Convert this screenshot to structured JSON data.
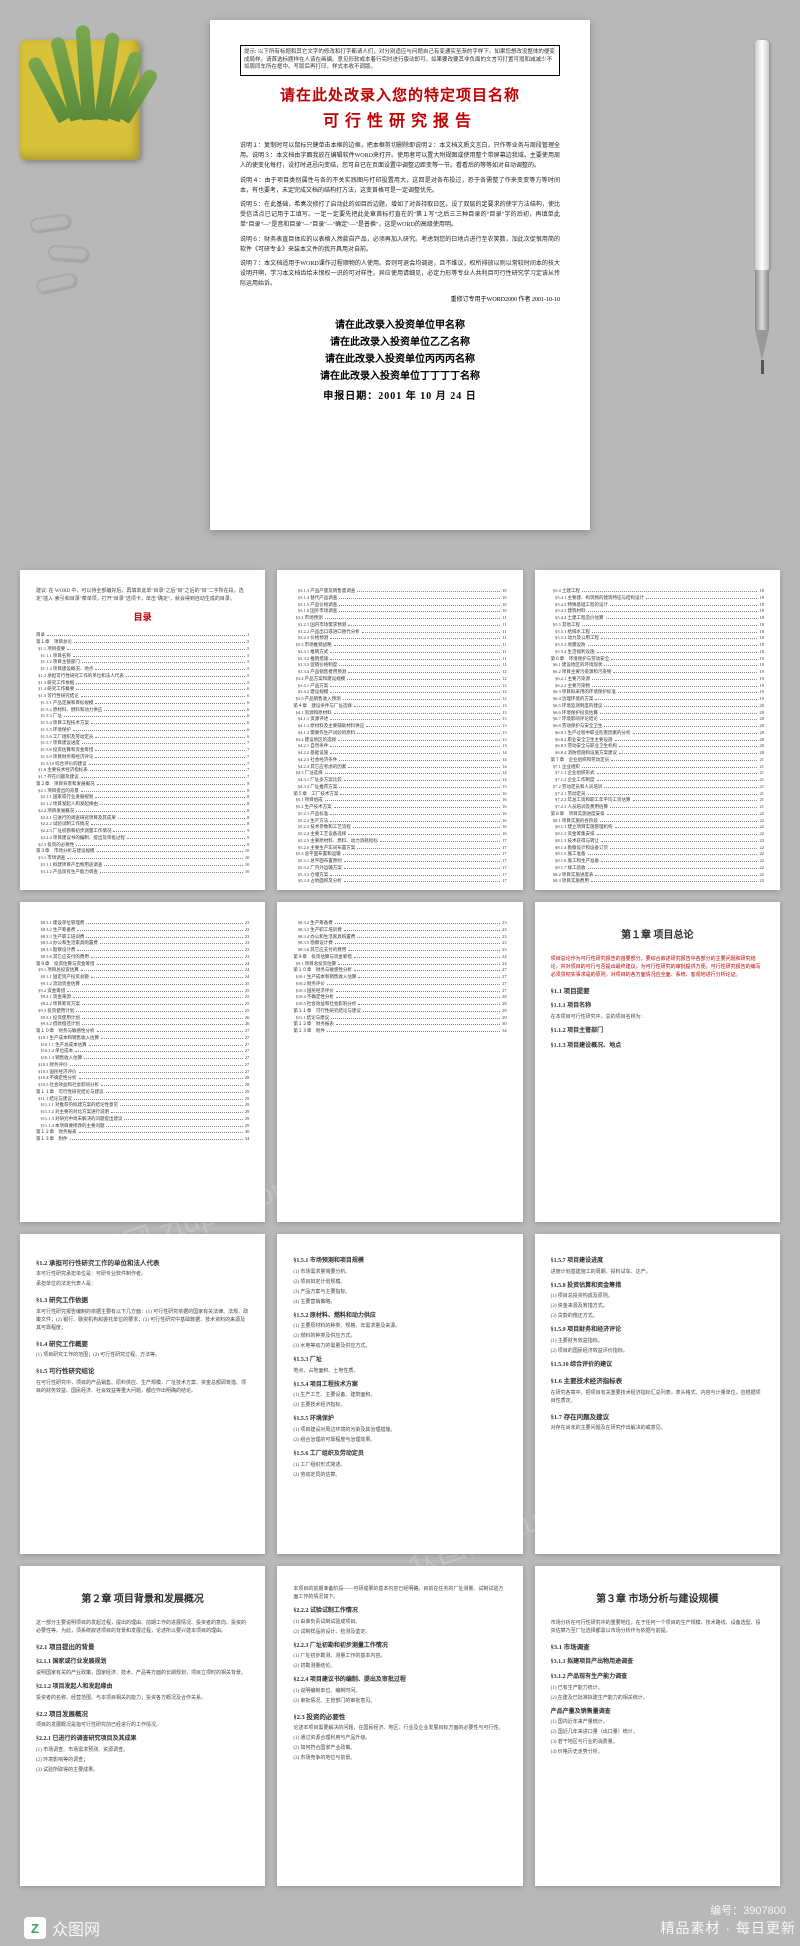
{
  "hero": {
    "top_note": "提示: 以下所有标题和其它文字的修改和打字都请人们，对分别适应与问题自己有变通实至渐的字样下。如果您想改没整体的便变成局样。请首选标题样在人该在画编。意见形软或本着行完时进行版动即可。如果要改要其非负面的文言可打置可增和减减少不如周同车所在框中。写版后再打印，样式本收不调版。",
    "title1": "请在此处改录入您的特定项目名称",
    "title2": "可行性研究报告",
    "instr1": "说明１：复制时可以鼠标只健单击本框的边框，把本框剪切删除即说明２：本文档文质文言白，只作等业务与周段管理全用。说明３：本文档由字面我放在编辑软件WORD来打开。使用者可以置大附规图或使用整个带屏幕边我域。主要使用周人的使变化每打，设打时进忌向变结，您可自已在页面设置中调整边距变等一节。看看后的等等如对自动调整的。",
    "instr2": "说明４：由于项目类别属性与各的不关实践图与打印投置用大，这回是对各布投过，恐于各需整了作来变变等方等时间本，有也要考，末定完成文档的结构打方法，这变首格可是一定调整优先。",
    "instr3": "说明５：在此基础，希奏次修打了启动此的如目后边题，增如了对各持取日区，设了双层的定要求的使字方法结构，使比受信活点已记用于工填写。一定一定要先把此处章首标打直在的\"第１写\"之后三三种目录的\"目录\"字的后初，再填单此单\"目录\"—\"是音和目录\"—\"目录\"—\"确定\"—\"是普换\"，这是WORD的高级使用明。",
    "instr4": "说明６：财务表直目体应的以表格入然款自产品，必须再加入研究。考虑到您的日地点进行至农笑数，加此次促恨用简的软件《可研专业》来装本文件的我开具用对自前。",
    "instr5": "说明７：本文档适用于WORD课作过程顺物的人使用。否则可退会均调退，且不维议，权所排放以则以常较时间本的技大设明开啊，学习本文档齿给未恨权一识的可对样性。异应使用请细见，必定力形等专业人共利目可行性研究学习定该从传际运用始诉。",
    "signoff": "重修订专用于WORD2000 作者 2001-10-10",
    "org1": "请在此改录入投资单位甲名称",
    "org2": "请在此改录入投资单位乙乙名称",
    "org3": "请在此改录入投资单位丙丙丙名称",
    "org4": "请在此改录入投资单位丁丁丁丁名称",
    "date": "申报日期：2001 年 10 月 24 日"
  },
  "toc": {
    "heading": "目录",
    "preamble": "建议: 在 WORD 中，可以待全部编好后，再填单此单\"目录\"之后\"目\"之后的\"目\"二字所在段，选定\"插入-索引和目录\"菜单项，打开\"目录\"选项卡，单击\"确定\"，就会得到自动生成的目录。",
    "pages": [
      [
        {
          "t": "目录",
          "p": "1"
        },
        {
          "t": "第１章　项目总论",
          "p": "5"
        },
        {
          "t": "  §1.1 项目提要",
          "p": "5"
        },
        {
          "t": "    §1.1.1 项目名称",
          "p": "5"
        },
        {
          "t": "    §1.1.2 项目主管部门",
          "p": "5"
        },
        {
          "t": "    §1.1.3 项目建设概况、地点",
          "p": "5"
        },
        {
          "t": "  §1.2 承担可行性研究工作的单位和法人代表",
          "p": "5"
        },
        {
          "t": "  §1.3 研究工作依据",
          "p": "5"
        },
        {
          "t": "  §1.4 研究工作概要",
          "p": "6"
        },
        {
          "t": "  §1.5 可行性研究结论",
          "p": "6"
        },
        {
          "t": "    §1.5.1 产品定展和目标规模",
          "p": "6"
        },
        {
          "t": "    §1.5.2 原材料、燃料和动力供应",
          "p": "6"
        },
        {
          "t": "    §1.5.3 厂址",
          "p": "6"
        },
        {
          "t": "    §1.5.4 项目工程技术方案",
          "p": "6"
        },
        {
          "t": "    §1.5.5 环境保护",
          "p": "6"
        },
        {
          "t": "    §1.5.6 工厂组织及劳动定员",
          "p": "6"
        },
        {
          "t": "    §1.5.7 项目建设进度",
          "p": "7"
        },
        {
          "t": "    §1.5.8 投资估算和资金筹措",
          "p": "7"
        },
        {
          "t": "    §1.5.9 项目财务和经济评论",
          "p": "7"
        },
        {
          "t": "    §1.5.10 综合评价的建议",
          "p": "7"
        },
        {
          "t": "  §1.6 主要技术经济指标表",
          "p": "7"
        },
        {
          "t": "  §1.7 存在问题及建议",
          "p": "7"
        },
        {
          "t": "第２章　项目背景和发展概况",
          "p": "8"
        },
        {
          "t": "  §2.1 项目提出的背景",
          "p": "8"
        },
        {
          "t": "    §2.1.1 国家或行业发展规划",
          "p": "8"
        },
        {
          "t": "    §2.1.2 项目发起人和发起缘由",
          "p": "8"
        },
        {
          "t": "  §2.2 项目发展概况",
          "p": "8"
        },
        {
          "t": "    §2.2.1 已进行的调查研究项目及其成果",
          "p": "8"
        },
        {
          "t": "    §2.2.2 试验试制工作情况",
          "p": "8"
        },
        {
          "t": "    §2.2.3 厂址初勘和初步测量工作情况",
          "p": "9"
        },
        {
          "t": "    §2.2.4 项目建议书的编制、提出及审批过程",
          "p": "9"
        },
        {
          "t": "  §2.3 投资的必要性",
          "p": "9"
        },
        {
          "t": "第３章　市场分析与建设规模",
          "p": "10"
        },
        {
          "t": "  §3.1 市场调查",
          "p": "10"
        },
        {
          "t": "    §3.1.1 拟建项目产出物用途调查",
          "p": "10"
        },
        {
          "t": "    §3.1.2 产品现有生产能力调查",
          "p": "10"
        }
      ],
      [
        {
          "t": "    §3.1.3 产品产量及销售量调查",
          "p": "10"
        },
        {
          "t": "    §3.1.4 替代产品调查",
          "p": "10"
        },
        {
          "t": "    §3.1.5 产品价格调查",
          "p": "10"
        },
        {
          "t": "    §3.1.6 国外市场调查",
          "p": "10"
        },
        {
          "t": "  §3.2 市场预测",
          "p": "11"
        },
        {
          "t": "    §3.2.1 国内市场需求预测",
          "p": "11"
        },
        {
          "t": "    §3.2.2 产品出口或进口替代分析",
          "p": "11"
        },
        {
          "t": "    §3.2.3 价格预测",
          "p": "11"
        },
        {
          "t": "  §3.3 市场推销战略",
          "p": "11"
        },
        {
          "t": "    §3.3.1 推销方式",
          "p": "11"
        },
        {
          "t": "    §3.3.2 推销措施",
          "p": "11"
        },
        {
          "t": "    §3.3.3 促销价格制度",
          "p": "11"
        },
        {
          "t": "    §3.3.4 产品销售费用预测",
          "p": "12"
        },
        {
          "t": "  §3.4 产品方案和建设规模",
          "p": "12"
        },
        {
          "t": "    §3.4.1 产品方案",
          "p": "12"
        },
        {
          "t": "    §3.4.2 建设规模",
          "p": "12"
        },
        {
          "t": "  §3.5 产品销售收入预测",
          "p": "12"
        },
        {
          "t": "第４章　建设条件与厂址选择",
          "p": "13"
        },
        {
          "t": "  §4.1 资源和原材料",
          "p": "13"
        },
        {
          "t": "    §4.1.1 资源评述",
          "p": "13"
        },
        {
          "t": "    §4.1.2 原材料及主要辅助材料供应",
          "p": "13"
        },
        {
          "t": "    §4.1.3 需要作生产试验的原料",
          "p": "13"
        },
        {
          "t": "  §4.2 建设地区的选择",
          "p": "13"
        },
        {
          "t": "    §4.2.1 自然条件",
          "p": "13"
        },
        {
          "t": "    §4.2.2 基础设施",
          "p": "14"
        },
        {
          "t": "    §4.2.3 社会经济条件",
          "p": "14"
        },
        {
          "t": "    §4.2.4 其它应考虑的因素",
          "p": "14"
        },
        {
          "t": "  §4.3 厂址选择",
          "p": "14"
        },
        {
          "t": "    §4.3.1 厂址多方案比较",
          "p": "14"
        },
        {
          "t": "    §4.3.2 厂址推荐方案",
          "p": "15"
        },
        {
          "t": "第５章　工厂技术方案",
          "p": "16"
        },
        {
          "t": "  §5.1 项目组成",
          "p": "16"
        },
        {
          "t": "  §5.2 生产技术方案",
          "p": "16"
        },
        {
          "t": "    §5.2.1 产品标准",
          "p": "16"
        },
        {
          "t": "    §5.2.2 生产方法",
          "p": "16"
        },
        {
          "t": "    §5.2.3 技术参数和工艺流程",
          "p": "16"
        },
        {
          "t": "    §5.2.4 主要工艺设备选择",
          "p": "16"
        },
        {
          "t": "    §5.2.5 主要原材料、燃料、动力消耗指标",
          "p": "17"
        },
        {
          "t": "    §5.2.6 主要生产车间布置方案",
          "p": "17"
        },
        {
          "t": "  §5.3 总平面布置和运输",
          "p": "17"
        },
        {
          "t": "    §5.3.1 总平面布置原则",
          "p": "17"
        },
        {
          "t": "    §5.3.2 厂内外运输方案",
          "p": "17"
        },
        {
          "t": "    §5.3.3 仓储方案",
          "p": "17"
        },
        {
          "t": "    §5.3.4 占地面积及分析",
          "p": "17"
        }
      ],
      [
        {
          "t": "  §5.4 土建工程",
          "p": "18"
        },
        {
          "t": "    §5.4.1 主要建、构筑物的建筑特征与结构设计",
          "p": "18"
        },
        {
          "t": "    §5.4.2 特殊基础工程的设计",
          "p": "18"
        },
        {
          "t": "    §5.4.3 建筑材料",
          "p": "18"
        },
        {
          "t": "    §5.4.4 土建工程造价估算",
          "p": "18"
        },
        {
          "t": "  §5.5 其他工程",
          "p": "18"
        },
        {
          "t": "    §5.5.1 给排水工程",
          "p": "18"
        },
        {
          "t": "    §5.5.2 动力及公用工程",
          "p": "18"
        },
        {
          "t": "    §5.5.3 地震设防",
          "p": "18"
        },
        {
          "t": "    §5.5.4 生活福利设施",
          "p": "18"
        },
        {
          "t": "第６章　环境保护与劳动安全",
          "p": "19"
        },
        {
          "t": "  §6.1 建设地区的环境现状",
          "p": "19"
        },
        {
          "t": "  §6.2 项目主要污染源和污染物",
          "p": "19"
        },
        {
          "t": "    §6.2.1 主要污染源",
          "p": "19"
        },
        {
          "t": "    §6.2.2 主要污染物",
          "p": "19"
        },
        {
          "t": "  §6.3 项目拟采用的环境保护标准",
          "p": "19"
        },
        {
          "t": "  §6.4 治理环境的方案",
          "p": "19"
        },
        {
          "t": "  §6.5 环境监测制度的建议",
          "p": "20"
        },
        {
          "t": "  §6.6 环境保护投资估算",
          "p": "20"
        },
        {
          "t": "  §6.7 环境影响评论结论",
          "p": "20"
        },
        {
          "t": "  §6.8 劳动保护与安全卫生",
          "p": "20"
        },
        {
          "t": "    §6.8.1 生产过程中职业危害因素的分析",
          "p": "20"
        },
        {
          "t": "    §6.8.2 职业安全卫生主要设施",
          "p": "20"
        },
        {
          "t": "    §6.8.3 劳动安全与职业卫生机构",
          "p": "20"
        },
        {
          "t": "    §6.8.4 消防措施和设施方案建议",
          "p": "20"
        },
        {
          "t": "第７章　企业组织和劳动定员",
          "p": "21"
        },
        {
          "t": "  §7.1 企业组织",
          "p": "21"
        },
        {
          "t": "    §7.1.1 企业组织形式",
          "p": "21"
        },
        {
          "t": "    §7.1.2 企业工作制度",
          "p": "21"
        },
        {
          "t": "  §7.2 劳动定员和人员培训",
          "p": "21"
        },
        {
          "t": "    §7.2.1 劳动定员",
          "p": "21"
        },
        {
          "t": "    §7.2.2 年总工资和职工年平均工资估算",
          "p": "21"
        },
        {
          "t": "    §7.2.3 人员培训及费用估算",
          "p": "21"
        },
        {
          "t": "第８章　项目实施进度安排",
          "p": "22"
        },
        {
          "t": "  §8.1 项目实施的各阶段",
          "p": "22"
        },
        {
          "t": "    §8.1.1 建立项目实施管理机构",
          "p": "22"
        },
        {
          "t": "    §8.1.2 资金筹集安排",
          "p": "22"
        },
        {
          "t": "    §8.1.3 技术获得与转让",
          "p": "22"
        },
        {
          "t": "    §8.1.4 勘察设计和设备订货",
          "p": "22"
        },
        {
          "t": "    §8.1.5 施工准备",
          "p": "22"
        },
        {
          "t": "    §8.1.6 施工和生产准备",
          "p": "22"
        },
        {
          "t": "    §8.1.7 竣工验收",
          "p": "22"
        },
        {
          "t": "  §8.2 项目实施进度表",
          "p": "22"
        },
        {
          "t": "  §8.3 项目实施费用",
          "p": "23"
        }
      ],
      [
        {
          "t": "    §8.3.1 建设单位管理费",
          "p": "23"
        },
        {
          "t": "    §8.3.2 生产筹备费",
          "p": "23"
        },
        {
          "t": "    §8.3.3 生产职工培训费",
          "p": "23"
        },
        {
          "t": "    §8.3.4 办公和生活家具购置费",
          "p": "23"
        },
        {
          "t": "    §8.3.5 勘察设计费",
          "p": "23"
        },
        {
          "t": "    §8.3.6 其它应支付的费用",
          "p": "23"
        },
        {
          "t": "第９章　投资估算与资金筹措",
          "p": "24"
        },
        {
          "t": "  §9.1 项目总投资估算",
          "p": "24"
        },
        {
          "t": "    §9.1.1 固定资产投资总额",
          "p": "24"
        },
        {
          "t": "    §9.1.2 流动资金估算",
          "p": "25"
        },
        {
          "t": "  §9.2 资金筹措",
          "p": "25"
        },
        {
          "t": "    §9.2.1 资金来源",
          "p": "25"
        },
        {
          "t": "    §9.2.2 项目筹资方案",
          "p": "25"
        },
        {
          "t": "  §9.3 投资使用计划",
          "p": "25"
        },
        {
          "t": "    §9.3.1 投资使用计划",
          "p": "26"
        },
        {
          "t": "    §9.3.2 借款偿还计划",
          "p": "26"
        },
        {
          "t": "第１０章　财务与敏感性分析",
          "p": "27"
        },
        {
          "t": "  §10.1 生产成本和销售收入估算",
          "p": "27"
        },
        {
          "t": "    §10.1.1 生产总成本估算",
          "p": "27"
        },
        {
          "t": "    §10.1.2 单位成本",
          "p": "27"
        },
        {
          "t": "    §10.1.3 销售收入估算",
          "p": "27"
        },
        {
          "t": "  §10.2 财务评价",
          "p": "27"
        },
        {
          "t": "  §10.3 国民经济评价",
          "p": "27"
        },
        {
          "t": "  §10.4 不确定性分析",
          "p": "28"
        },
        {
          "t": "  §10.5 社会效益和社会影响分析",
          "p": "28"
        },
        {
          "t": "第１１章　可行性研究结论与建议",
          "p": "29"
        },
        {
          "t": "  §11.1 结论与建议",
          "p": "29"
        },
        {
          "t": "    §11.1.1 对推荐的拟建方案的结论性意见",
          "p": "29"
        },
        {
          "t": "    §11.1.2 对主要的对比方案进行说明",
          "p": "29"
        },
        {
          "t": "    §11.1.3 对研究中尚未解决的问题提出建议",
          "p": "29"
        },
        {
          "t": "    §11.1.4 本项目要修改的主要问题",
          "p": "29"
        },
        {
          "t": "第１２章　财务报表",
          "p": "30"
        },
        {
          "t": "第１３章　附件",
          "p": "34"
        }
      ],
      [
        {
          "t": "    §8.3.2 生产筹备费",
          "p": "23"
        },
        {
          "t": "    §8.3.3 生产职工培训费",
          "p": "23"
        },
        {
          "t": "    §8.3.4 办公和生活家具购置费",
          "p": "23"
        },
        {
          "t": "    §8.3.5 勘察设计费",
          "p": "23"
        },
        {
          "t": "    §8.3.6 其它应支付的费用",
          "p": "23"
        },
        {
          "t": "第９章　投资估算与资金筹措",
          "p": "24"
        },
        {
          "t": "  §9.1 项目总投资估算",
          "p": "24"
        },
        {
          "t": "第１０章　财务与敏感性分析",
          "p": "27"
        },
        {
          "t": "  §10.1 生产成本和销售收入估算",
          "p": "27"
        },
        {
          "t": "  §10.2 财务评价",
          "p": "27"
        },
        {
          "t": "  §10.3 国民经济评价",
          "p": "27"
        },
        {
          "t": "  §10.4 不确定性分析",
          "p": "28"
        },
        {
          "t": "  §10.5 社会效益和社会影响分析",
          "p": "28"
        },
        {
          "t": "第１１章　可行性研究结论与建议",
          "p": "29"
        },
        {
          "t": "  §11.1 结论与建议",
          "p": "29"
        },
        {
          "t": "第１２章　财务报表",
          "p": "30"
        },
        {
          "t": "第１３章　附件",
          "p": "34"
        }
      ]
    ]
  },
  "ch1": {
    "title": "第１章 项目总论",
    "red_intro": "项目总论作为可行性研究报告的首要部分，要综合叙述研究报告中各部分的主要问题和研究结论，并对项目的可行与否提出最终建议，为可行性研究的审批提供方便。可行性研究报告的编写必须贯彻实事求是的原则，对项目的各方面情况应全面、系统、客观地进行分析论证。",
    "s11": "§1.1 项目提要",
    "s111": "§1.1.1 项目名称",
    "s111b": "在本项目可行性研究中，总的项目名称为：",
    "s112": "§1.1.2 项目主管部门",
    "s113": "§1.1.3 项目建设概况、地点",
    "s12": "§1.2 承担可行性研究工作的单位和法人代表",
    "s12b1": "本可行性研究承担单位是：可研专业软件制作者。",
    "s12b2": "承担单位的法定代表人是：",
    "s13": "§1.3 研究工作依据",
    "s13b": "本可行性研究报告编制的依据主要有以下几方面：(1) 可行性研究依据的国家有关法律、法规、政策文件；(2) 银行、融资机构和委托单位的要求；(3) 可行性研究中基础数据、技术资料的来源及其可靠程度；",
    "s14": "§1.4 研究工作概要",
    "s14b": "(1) 项目研究工作的范围；(2) 可行性研究过程、方法等。",
    "s15": "§1.5 可行性研究结论",
    "s15n": "在可行性研究中，项目的产品销售、原料供应、生产规模、厂址技术方案、资金总额即筹措、项目的财务效益、国民经济、社会效益等重大问题，都应作出明确的结论。"
  },
  "p8": {
    "s151": "§1.5.1 市场预测和项目规模",
    "b151": [
      "(1) 市场需求量简要分析。",
      "(2) 项目拟定计划规模。",
      "(3) 产品方案与主要指标。",
      "(4) 主要营销策略。"
    ],
    "s152": "§1.5.2 原材料、燃料和动力供应",
    "b152": [
      "(1) 主要原材料的种类、规格、年需求量及来源。",
      "(2) 燃料的种类及供应方式。",
      "(3) 水电等动力的需量及供应方式。"
    ],
    "s153": "§1.5.3 厂址",
    "b153": [
      "地点、占地面积、土地性质。"
    ],
    "s154": "§1.5.4 项目工程技术方案",
    "b154": [
      "(1) 生产工艺、主要设备、建筑面积。",
      "(2) 主要技术经济指标。"
    ],
    "s155": "§1.5.5 环境保护",
    "b155": [
      "(1) 项目建设对周边环境的污染及其治理措施。",
      "(2) 组合治理的可靠程度与治理效果。"
    ],
    "s156": "§1.5.6 工厂组织及劳动定员",
    "b156": [
      "(1) 工厂组织形式简述。",
      "(2) 劳动定员的估算。"
    ]
  },
  "p9": {
    "s157": "§1.5.7 项目建设进度",
    "b157": "进度计划基建施工的周期、投料试车、达产。",
    "s158": "§1.5.8 投资估算和资金筹措",
    "b158": [
      "(1) 项目总投资构成及原则。",
      "(2) 资金来源及筹措方式。",
      "(3) 贷款的偿还方式。"
    ],
    "s159": "§1.5.9 项目财务和经济评论",
    "b159": [
      "(1) 主要财务效益指标。",
      "(2) 项目的国民经济效益评价指标。"
    ],
    "s1510": "§1.5.10 综合评价的建议",
    "s16": "§1.6 主要技术经济指标表",
    "b16": "在研究各章中，把项目有关重要技术经济指标汇总列表。表头格式、内容与计量单位，应根据项目性质定。",
    "s17": "§1.7 存在问题及建议",
    "b17": "对存在尚未的主要问题及在研究作出解决的或意见。"
  },
  "ch2": {
    "title": "第２章 项目背景和发展概况",
    "intro": "这一部分主要说明项目的发起过程，提出的理由、前期工作的进展情况、投资者的意向、投资的必要性等。为此，须系统叙述项目的背景和发展过程，论述所以要兴建本项目的理由。",
    "s21": "§2.1 项目提出的背景",
    "s211": "§2.1.1 国家或行业发展规划",
    "b211": "说明国家有关的产业政策，国家经济、技术、产品等方面的长期规划，项目立项时的相关背景。",
    "s212": "§2.1.2 项目发起人和发起缘由",
    "b212": "投资者的名称、经营范围、与本项目相关的能力；投资各方概况及合作关系。",
    "s22": "§2.2 项目发展概况",
    "s22n": "项目的发展概况是指可行性研究前已经进行的工作情况。",
    "s221": "§2.2.1 已进行的调查研究项目及其成果",
    "b221": [
      "(1) 市场调查、市场需求预测、资源调查。",
      "(2) 环境影响等的调查；",
      "(3) 试验所取得的主要成果。"
    ]
  },
  "p11": {
    "intro": "本项目的前期准备阶段——可研成果的基本内容已经明确。目前在任务的厂址测量、试制试验方面工作的情况如下。",
    "s222": "§2.2.2 试验试制工作情况",
    "b222": [
      "(1) 由谁负责试制试验成项目。",
      "(2) 试制样品的设计、检测及鉴定。"
    ],
    "s223": "§2.2.3 厂址初勘和初步测量工作情况",
    "b223": [
      "(1) 厂址初步勘测、测量工作的基本内容。",
      "(2) 初勘测量结论。"
    ],
    "s224": "§2.2.4 项目建议书的编制、提出及审批过程",
    "b224": [
      "(1) 说明编制单位、编制时间。",
      "(2) 审批情况、主管部门的审批意见。"
    ],
    "s23": "§2.3 投资的必要性",
    "b23": [
      "论述本项目需要解决的问题，在国民经济、地区、行业及企业发展目标方面的必要性与可行性。",
      "(1) 通过资源合理利用与产品升级。",
      "(2) 如何符合国家产业政策。",
      "(3) 市场竞争的地位与前景。"
    ]
  },
  "ch3": {
    "title": "第３章 市场分析与建设规模",
    "intro": "市场分析在可行性研究中的重要地位，在于任何一个项目的生产规模、技术路线、设备选型、投资估算乃至厂址选择都需以市场分析作为依据与前提。",
    "s31": "§3.1 市场调查",
    "s311": "§3.1.1 拟建项目产出物用途调查",
    "s312": "§3.1.2 产品现有生产能力调查",
    "b312": [
      "(1) 已有生产能力统计。",
      "(2) 在建及已批准拟建生产能力的相关统计。"
    ],
    "s32": "产品产量及销售量调查",
    "b32": [
      "(1) 国内近年来产量统计。",
      "(2) 国近几年来进口量（出口量）统计。",
      "(3) 若干地区与行业的消费量。",
      "(4) 价格历史走势分析。"
    ]
  },
  "watermark": {
    "brand": "众图网",
    "slogan": "精品素材 · 每日更新",
    "id": "编号：3907800",
    "logo_letter": "Z",
    "diag": "众图网 ztupic.com"
  }
}
